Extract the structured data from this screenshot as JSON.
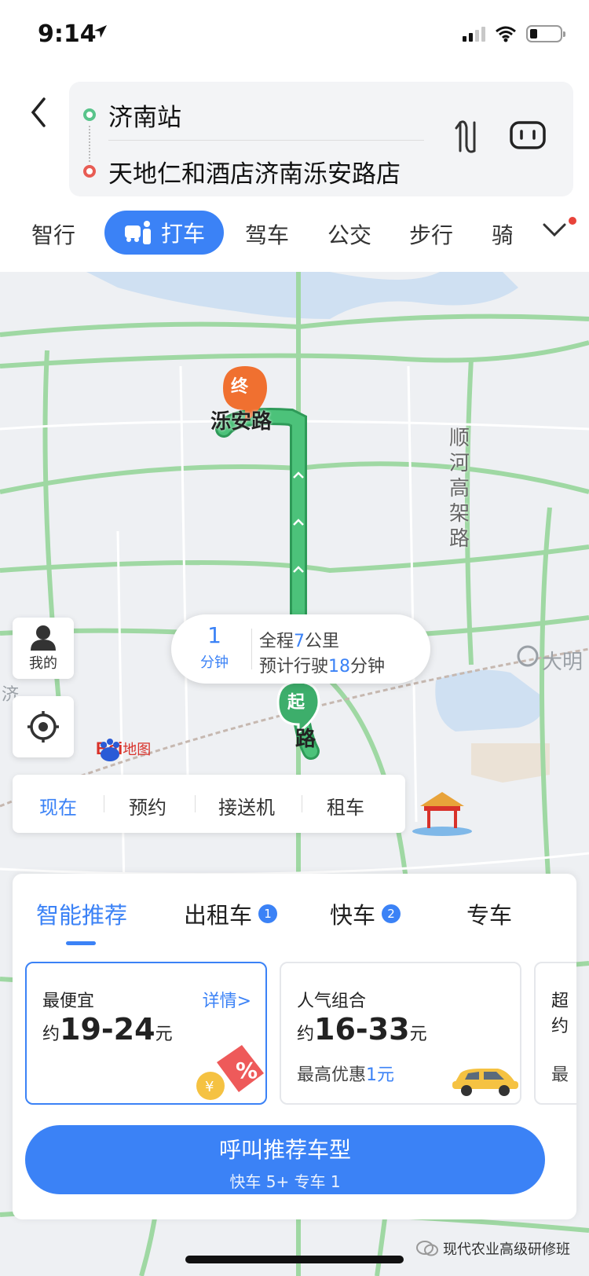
{
  "status_bar": {
    "time": "9:14"
  },
  "route": {
    "start": "济南站",
    "end": "天地仁和酒店济南泺安路店"
  },
  "modes": {
    "items": [
      "智行",
      "打车",
      "驾车",
      "公交",
      "步行",
      "骑"
    ],
    "active": "打车"
  },
  "map": {
    "end_marker": "终",
    "end_label": "泺安路",
    "start_marker": "起",
    "start_road_char": "路",
    "road_label": "顺河高架路",
    "poi_label": "大明",
    "edge_label": "济",
    "info": {
      "minutes": "1",
      "minutes_unit": "分钟",
      "distance_prefix": "全程",
      "distance_value": "7",
      "distance_unit": "公里",
      "time_prefix": "预计行驶",
      "time_value": "18",
      "time_unit": "分钟"
    },
    "mine_label": "我的",
    "logo_bai": "Bai",
    "logo_map": "地图"
  },
  "time_modes": [
    "现在",
    "预约",
    "接送机",
    "租车"
  ],
  "panel": {
    "tabs": [
      {
        "label": "智能推荐",
        "badge": ""
      },
      {
        "label": "出租车",
        "badge": "1"
      },
      {
        "label": "快车",
        "badge": "2"
      },
      {
        "label": "专车",
        "badge": ""
      }
    ],
    "cards": [
      {
        "title": "最便宜",
        "prefix": "约",
        "price": "19-24",
        "suffix": "元",
        "detail": "详情>",
        "sub": ""
      },
      {
        "title": "人气组合",
        "prefix": "约",
        "price": "16-33",
        "suffix": "元",
        "sub_prefix": "最高优惠",
        "sub_value": "1元"
      },
      {
        "title": "超",
        "prefix": "约",
        "price": "",
        "suffix": "",
        "sub": "最"
      }
    ],
    "call_button": {
      "label": "呼叫推荐车型",
      "sub": "快车 5+ 专车 1"
    }
  },
  "watermark": "现代农业高级研修班",
  "colors": {
    "accent": "#3b82f6",
    "route": "#3dae6b",
    "marker_end": "#f07030"
  }
}
